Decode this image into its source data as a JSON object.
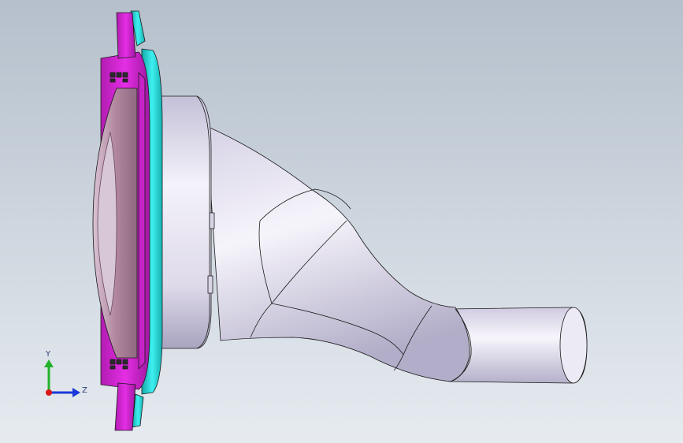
{
  "viewport": {
    "background_top": "#b5c0cc",
    "background_bottom": "#e6ebf0"
  },
  "part": {
    "body_color": "#e9e6f2",
    "shadow_color": "#a9a4bf",
    "flange_color": "#e020e0",
    "flange_dark": "#8a1a8a",
    "ring_color": "#1fd4d4",
    "lens_color": "#b58aa6",
    "edge_color": "#1a1a1a"
  },
  "triad": {
    "y_label": "Y",
    "z_label": "Z",
    "y_color": "#22b22a",
    "z_color": "#1a39d8",
    "x_color": "#d81818"
  }
}
